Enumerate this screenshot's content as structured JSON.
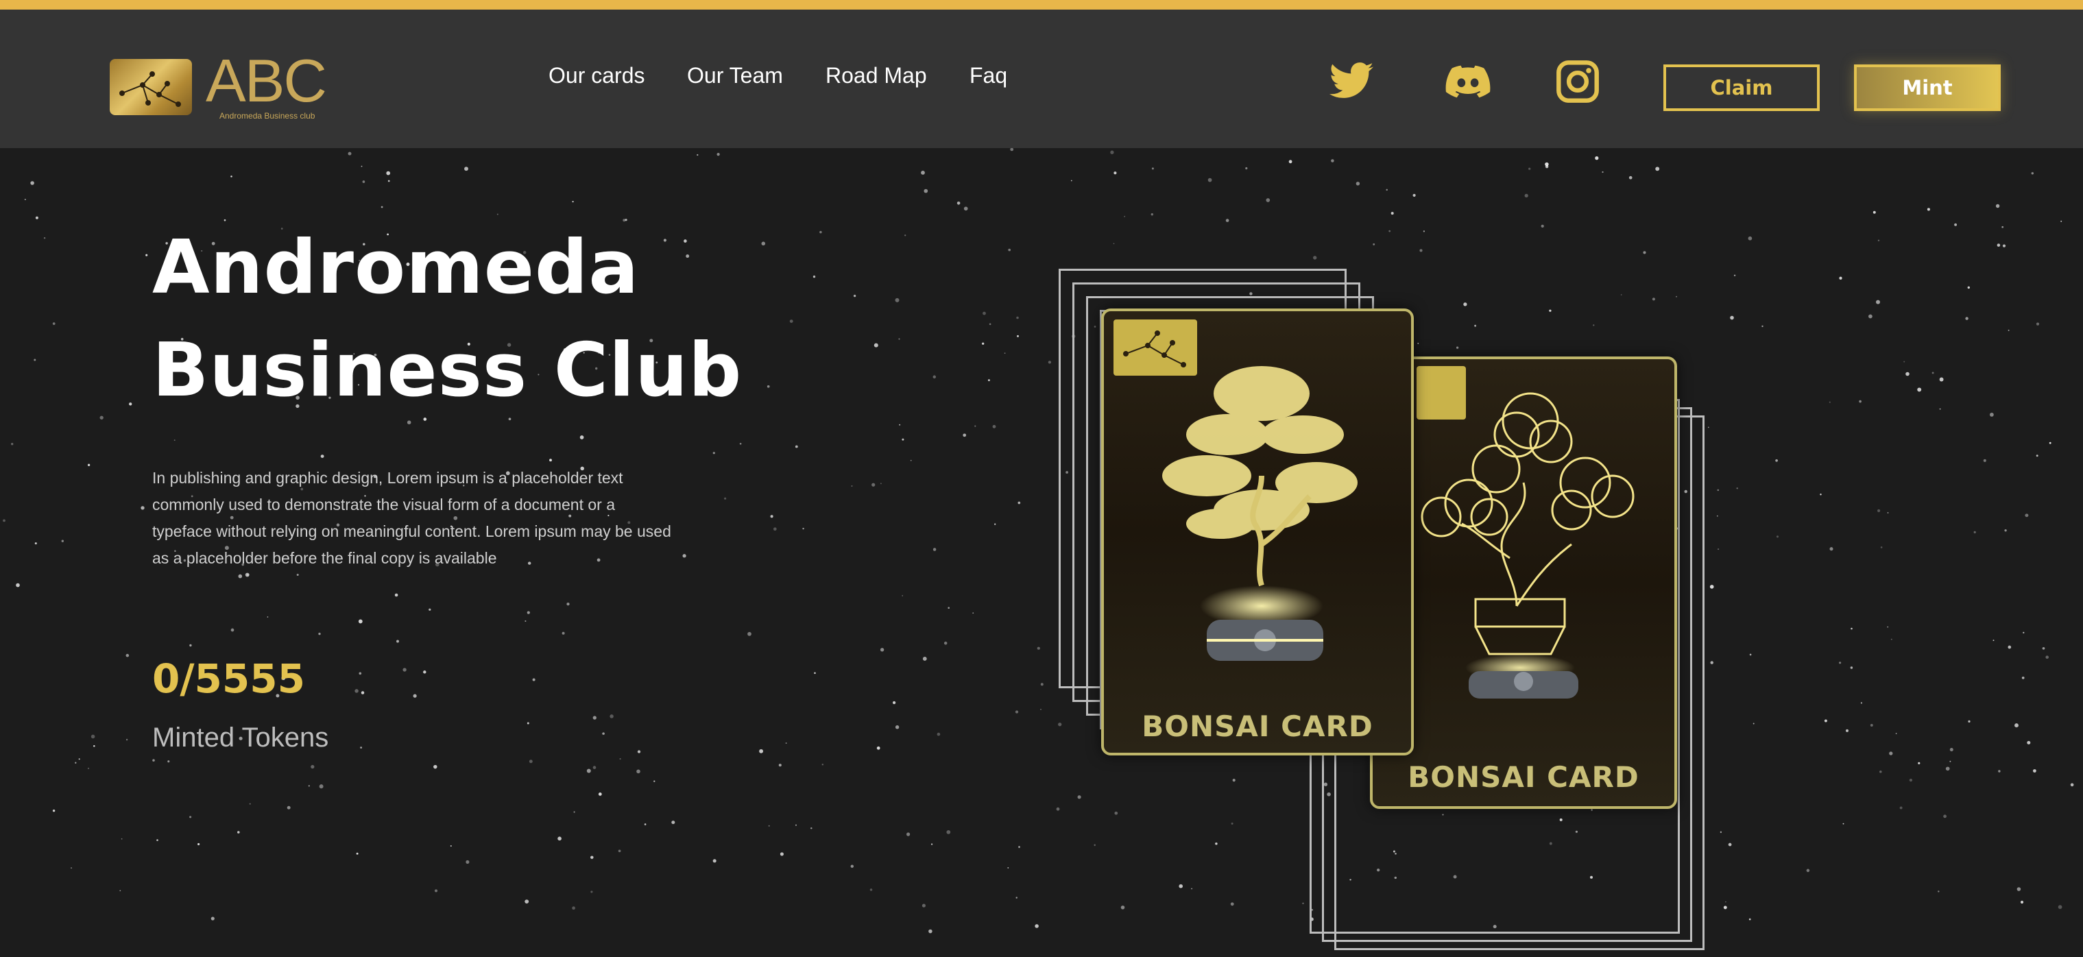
{
  "brand": {
    "name": "ABC",
    "tagline": "Andromeda Business club"
  },
  "nav": {
    "items": [
      {
        "label": "Our cards"
      },
      {
        "label": "Our Team"
      },
      {
        "label": "Road Map"
      },
      {
        "label": "Faq"
      }
    ]
  },
  "social": {
    "icons": [
      "twitter-icon",
      "discord-icon",
      "instagram-icon"
    ],
    "color": "#e3c24f"
  },
  "buttons": {
    "claim_label": "Claim",
    "mint_label": "Mint"
  },
  "hero": {
    "title_line1": "Andromeda",
    "title_line2": "Business Club",
    "description": "In publishing and graphic design, Lorem ipsum is a placeholder text commonly used to demonstrate the visual form of a document or a typeface without relying on meaningful content. Lorem ipsum may be used as a placeholder before the final copy is available",
    "minted_count": "0/5555",
    "minted_label": "Minted Tokens"
  },
  "cards": [
    {
      "label": "BONSAI CARD"
    },
    {
      "label": "BONSAI CARD"
    }
  ],
  "colors": {
    "accent": "#e3c24f",
    "top_line": "#e8b64a",
    "header_bg": "#343434",
    "page_bg": "#1c1c1c"
  }
}
